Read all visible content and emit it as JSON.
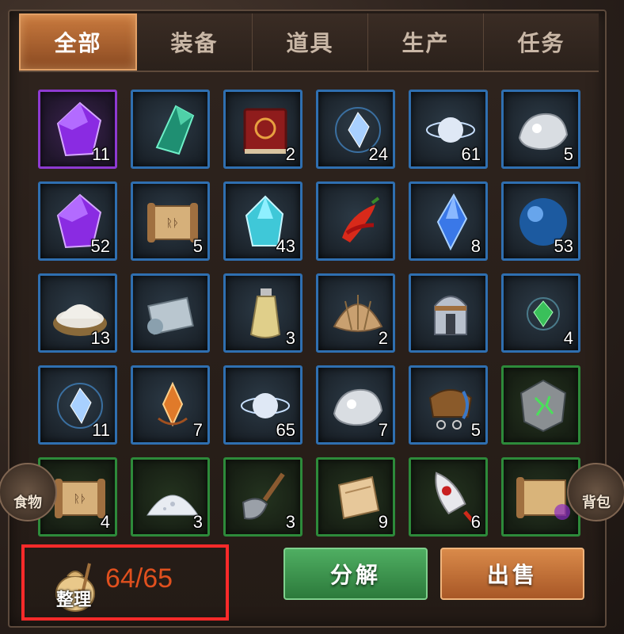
{
  "tabs": [
    {
      "label": "全部",
      "active": true
    },
    {
      "label": "装备",
      "active": false
    },
    {
      "label": "道具",
      "active": false
    },
    {
      "label": "生产",
      "active": false
    },
    {
      "label": "任务",
      "active": false
    }
  ],
  "items": [
    {
      "icon": "purple-gem-icon",
      "count": "11",
      "rarity": "purple"
    },
    {
      "icon": "green-crystal-icon",
      "count": "",
      "rarity": "blue"
    },
    {
      "icon": "red-book-icon",
      "count": "2",
      "rarity": "blue"
    },
    {
      "icon": "blue-spirit-icon",
      "count": "24",
      "rarity": "blue"
    },
    {
      "icon": "silver-orb-icon",
      "count": "61",
      "rarity": "blue"
    },
    {
      "icon": "silver-ore-icon",
      "count": "5",
      "rarity": "blue"
    },
    {
      "icon": "purple-gem-icon",
      "count": "52",
      "rarity": "blue"
    },
    {
      "icon": "scroll-icon",
      "count": "5",
      "rarity": "blue"
    },
    {
      "icon": "cyan-crystal-icon",
      "count": "43",
      "rarity": "blue"
    },
    {
      "icon": "chili-pepper-icon",
      "count": "",
      "rarity": "blue"
    },
    {
      "icon": "blue-crystal-icon",
      "count": "8",
      "rarity": "blue"
    },
    {
      "icon": "blue-sphere-icon",
      "count": "53",
      "rarity": "blue"
    },
    {
      "icon": "salt-bowl-icon",
      "count": "13",
      "rarity": "blue"
    },
    {
      "icon": "cloth-roll-icon",
      "count": "",
      "rarity": "blue"
    },
    {
      "icon": "potion-vial-icon",
      "count": "3",
      "rarity": "blue"
    },
    {
      "icon": "shell-icon",
      "count": "2",
      "rarity": "blue"
    },
    {
      "icon": "helmet-icon",
      "count": "",
      "rarity": "blue"
    },
    {
      "icon": "green-gem-icon",
      "count": "4",
      "rarity": "blue"
    },
    {
      "icon": "blue-spirit-icon",
      "count": "11",
      "rarity": "blue"
    },
    {
      "icon": "orange-flame-icon",
      "count": "7",
      "rarity": "blue"
    },
    {
      "icon": "silver-orb-icon",
      "count": "65",
      "rarity": "blue"
    },
    {
      "icon": "silver-ore-icon",
      "count": "7",
      "rarity": "blue"
    },
    {
      "icon": "saddle-icon",
      "count": "5",
      "rarity": "blue"
    },
    {
      "icon": "rune-stone-icon",
      "count": "",
      "rarity": "green"
    },
    {
      "icon": "scroll-icon",
      "count": "4",
      "rarity": "green"
    },
    {
      "icon": "salt-pile-icon",
      "count": "3",
      "rarity": "green"
    },
    {
      "icon": "shovel-icon",
      "count": "3",
      "rarity": "green"
    },
    {
      "icon": "paper-icon",
      "count": "9",
      "rarity": "green"
    },
    {
      "icon": "rocket-icon",
      "count": "6",
      "rarity": "green"
    },
    {
      "icon": "map-scroll-icon",
      "count": "",
      "rarity": "green"
    }
  ],
  "side_left": {
    "label": "食物"
  },
  "side_right": {
    "label": "背包"
  },
  "sort": {
    "label": "整理",
    "capacity": "64/65"
  },
  "buttons": {
    "decompose": "分解",
    "sell": "出售"
  },
  "colors": {
    "purple_border": "#8e3ad1",
    "blue_border": "#2f6fb0",
    "green_border": "#2d8a3a",
    "capacity_text": "#e0501e",
    "highlight": "#ff2a2a"
  }
}
